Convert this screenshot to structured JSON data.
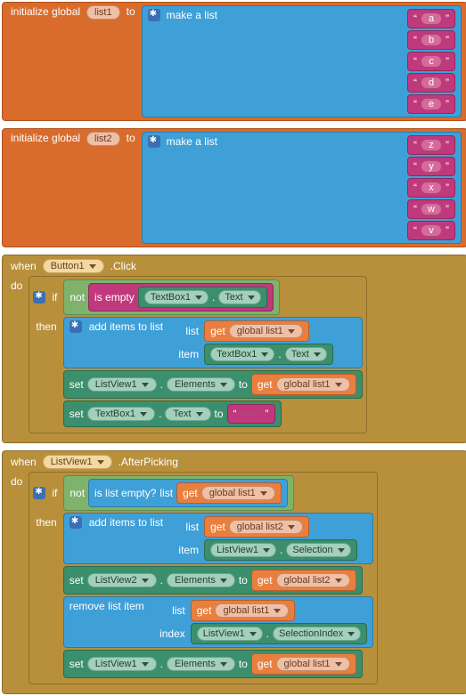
{
  "globals": [
    {
      "decl_prefix": "initialize global",
      "name": "list1",
      "decl_to": "to",
      "maker": "make a list",
      "items": [
        "a",
        "b",
        "c",
        "d",
        "e"
      ]
    },
    {
      "decl_prefix": "initialize global",
      "name": "list2",
      "decl_to": "to",
      "maker": "make a list",
      "items": [
        "z",
        "y",
        "x",
        "w",
        "v"
      ]
    }
  ],
  "handlers": [
    {
      "when": "when",
      "component": "Button1",
      "event": ".Click",
      "do": "do",
      "if_kw": "if",
      "then_kw": "then",
      "cond_not": "not",
      "cond_pred": "is empty",
      "cond_arg_comp": "TextBox1",
      "cond_arg_prop": "Text",
      "add_kw": "add items to list",
      "add_list_lbl": "list",
      "add_item_lbl": "item",
      "add_list_get": "get",
      "add_list_var": "global list1",
      "add_item_comp": "TextBox1",
      "add_item_prop": "Text",
      "set1_kw": "set",
      "set1_comp": "ListView1",
      "set1_prop": "Elements",
      "set1_to": "to",
      "set1_get": "get",
      "set1_var": "global list1",
      "set2_kw": "set",
      "set2_comp": "TextBox1",
      "set2_prop": "Text",
      "set2_to": "to",
      "set2_val": ""
    },
    {
      "when": "when",
      "component": "ListView1",
      "event": ".AfterPicking",
      "do": "do",
      "if_kw": "if",
      "then_kw": "then",
      "cond_not": "not",
      "cond_pred": "is list empty?",
      "cond_pred_lbl": "list",
      "cond_get": "get",
      "cond_var": "global list1",
      "add_kw": "add items to list",
      "add_list_lbl": "list",
      "add_item_lbl": "item",
      "add_list_get": "get",
      "add_list_var": "global list2",
      "add_item_comp": "ListView1",
      "add_item_prop": "Selection",
      "set1_kw": "set",
      "set1_comp": "ListView2",
      "set1_prop": "Elements",
      "set1_to": "to",
      "set1_get": "get",
      "set1_var": "global list2",
      "rem_kw": "remove list item",
      "rem_list_lbl": "list",
      "rem_idx_lbl": "index",
      "rem_get": "get",
      "rem_var": "global list1",
      "rem_idx_comp": "ListView1",
      "rem_idx_prop": "SelectionIndex",
      "set2_kw": "set",
      "set2_comp": "ListView1",
      "set2_prop": "Elements",
      "set2_to": "to",
      "set2_get": "get",
      "set2_var": "global list1"
    }
  ]
}
